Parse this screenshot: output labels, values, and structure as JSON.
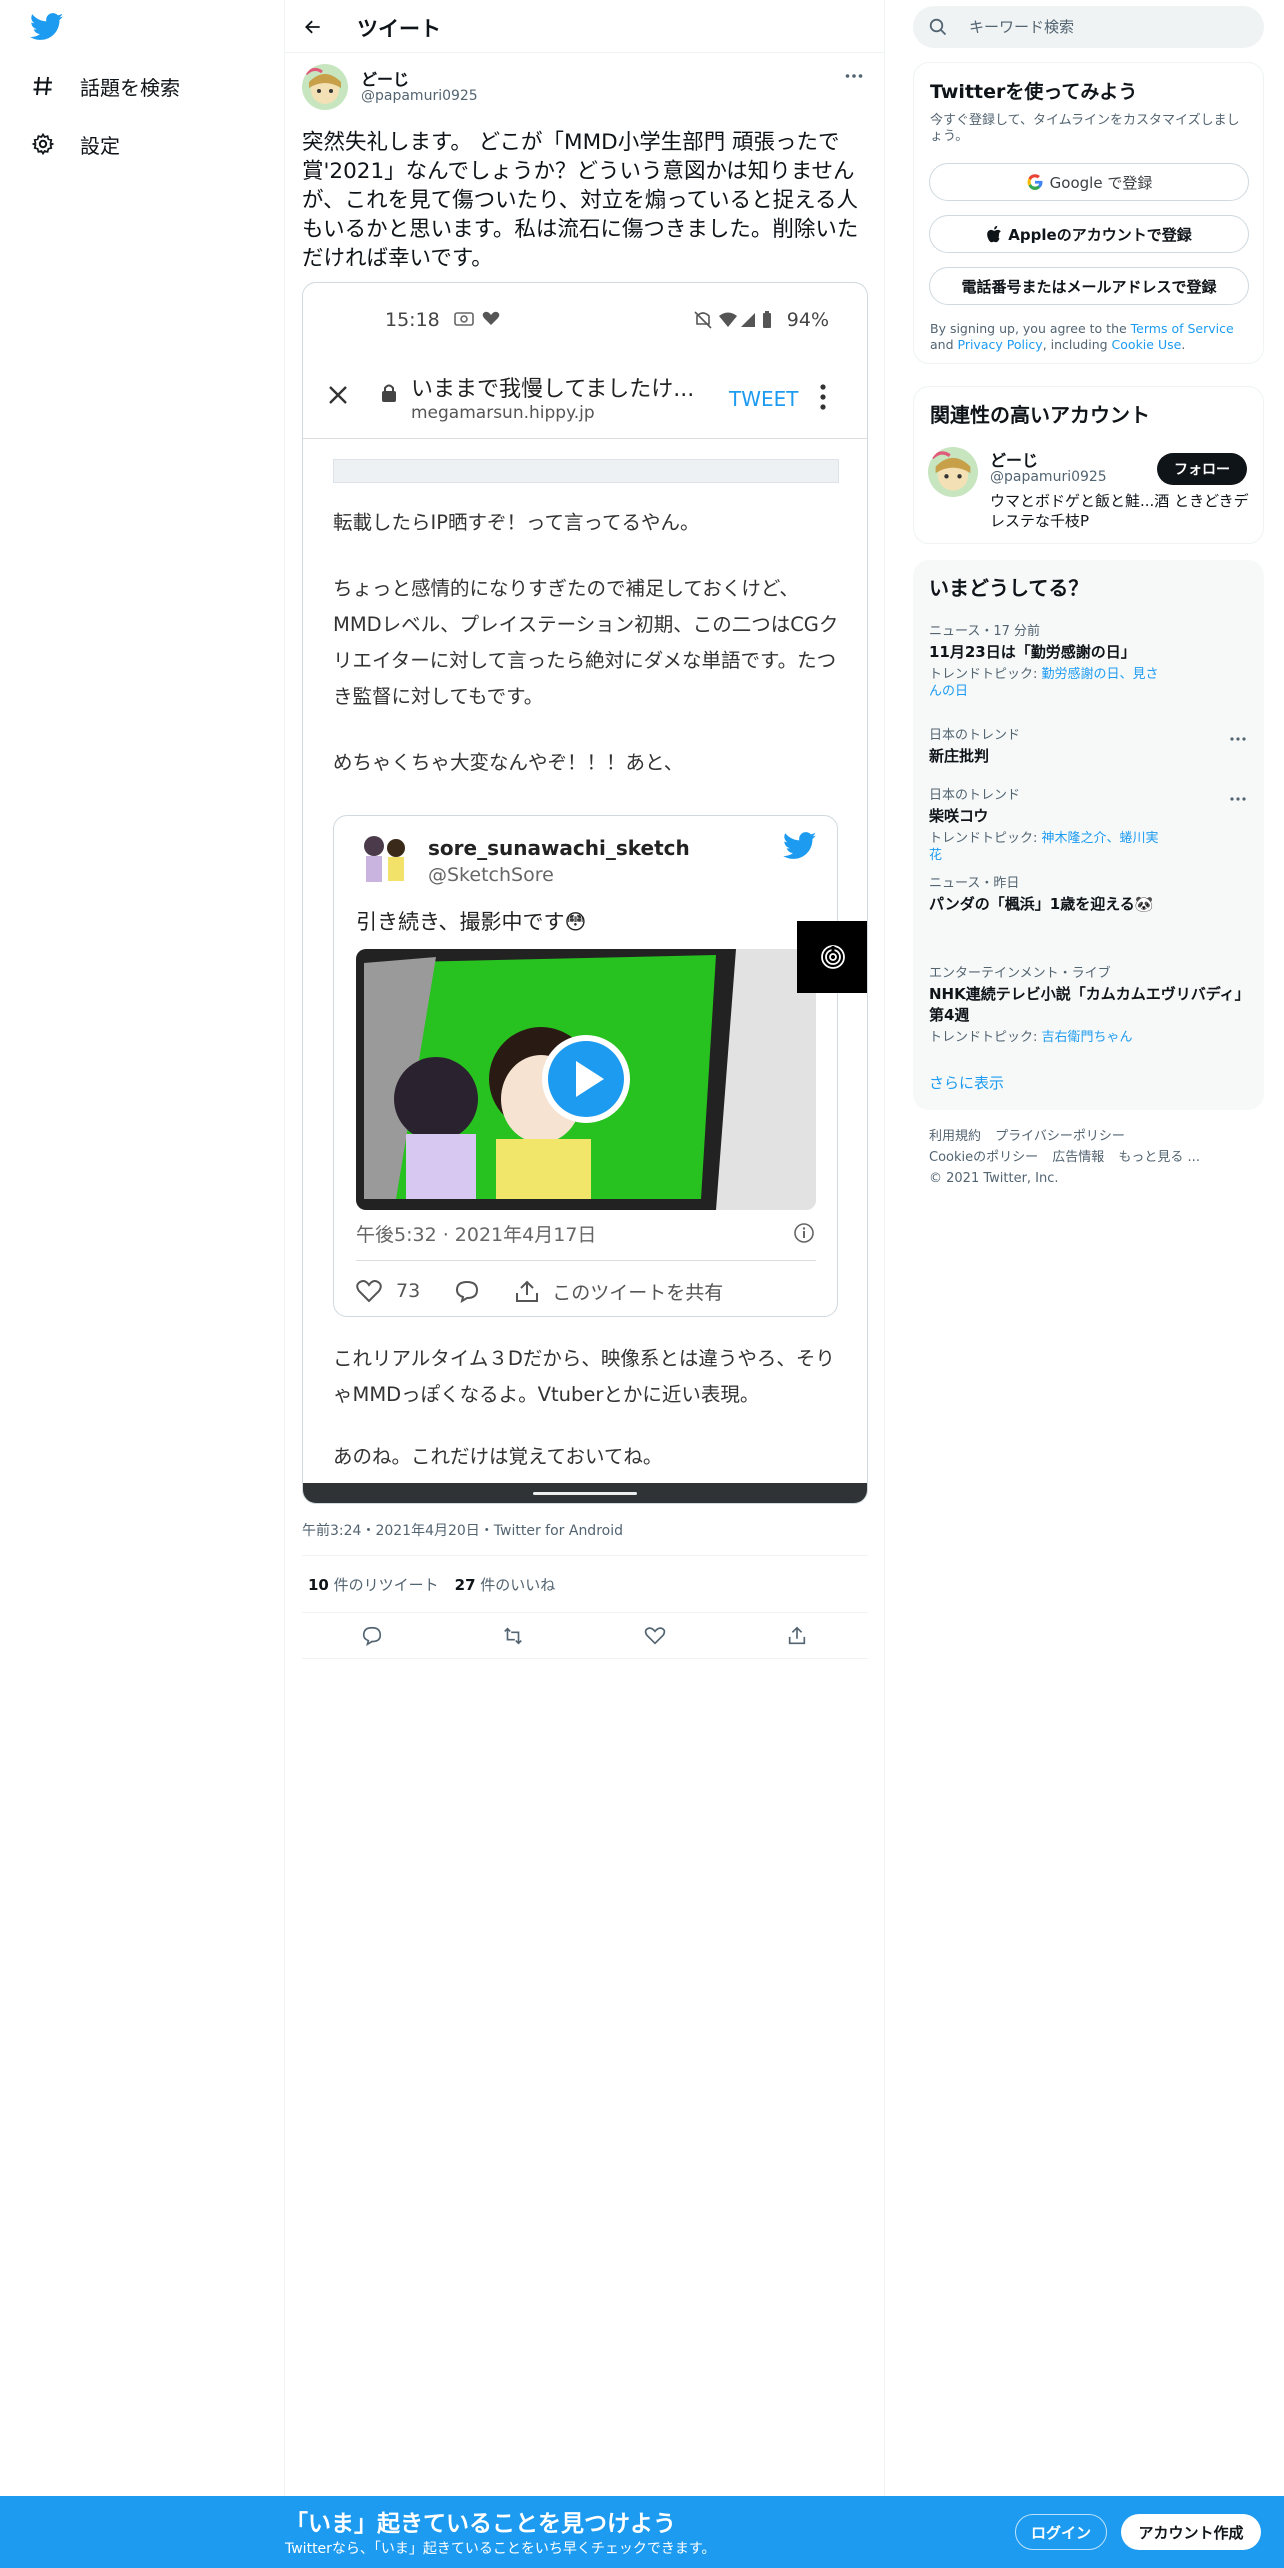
{
  "colors": {
    "accent": "#1d9bf0",
    "text": "#0f1419",
    "muted": "#536471",
    "banner": "#1d9bf0"
  },
  "nav": {
    "logo_icon": "twitter-bird-icon",
    "items": [
      {
        "label": "話題を検索",
        "icon": "hashtag-icon"
      },
      {
        "label": "設定",
        "icon": "gear-icon"
      }
    ]
  },
  "header": {
    "title": "ツイート",
    "back_icon": "arrow-left-icon"
  },
  "tweet": {
    "author_name": "どーじ",
    "author_handle": "@papamuri0925",
    "text": "突然失礼します。 どこが「MMD小学生部門 頑張ったで賞'2021」なんでしょうか？どういう意図かは知りませんが、これを見て傷ついたり、対立を煽っていると捉える人もいるかと思います。私は流石に傷つきました。削除いただければ幸いです。",
    "meta": "午前3:24・2021年4月20日・Twitter for Android",
    "retweet_count": "10",
    "retweet_label": " 件のリツイート",
    "like_count": "27",
    "like_label": " 件のいいね"
  },
  "phone": {
    "time": "15:18",
    "battery": "94%",
    "browser_title": "いままで我慢してましたけ...",
    "browser_url": "megamarsun.hippy.jp",
    "browser_tweet": "TWEET",
    "para1": "転載したらIP晒すぞ！って言ってるやん。",
    "para2": "ちょっと感情的になりすぎたので補足しておくけど、MMDレベル、プレイステーション初期、この二つはCGクリエイターに対して言ったら絶対にダメな単語です。たつき監督に対してもです。",
    "para3": "めちゃくちゃ大変なんやぞ！！！あと、",
    "para4": "これリアルタイム３Dだから、映像系とは違うやろ、そりゃMMDっぽくなるよ。Vtuberとかに近い表現。",
    "para5": "あのね。これだけは覚えておいてね。",
    "embed": {
      "name": "sore_sunawachi_sketch",
      "handle": "@SketchSore",
      "text": "引き続き、撮影中です😳",
      "time": "午後5:32 · 2021年4月17日",
      "likes": "73",
      "share": "このツイートを共有"
    }
  },
  "search": {
    "placeholder": "キーワード検索"
  },
  "signup": {
    "title": "Twitterを使ってみよう",
    "subtitle": "今すぐ登録して、タイムラインをカスタマイズしましょう。",
    "google": "Google で登録",
    "apple": "Appleのアカウントで登録",
    "phone": "電話番号またはメールアドレスで登録",
    "terms_1": "By signing up, you agree to the ",
    "terms_link1": "Terms of Service",
    "terms_2": " and ",
    "terms_link2": "Privacy Policy",
    "terms_3": ", including ",
    "terms_link3": "Cookie Use",
    "terms_4": "."
  },
  "related": {
    "title": "関連性の高いアカウント",
    "name": "どーじ",
    "handle": "@papamuri0925",
    "bio": "ウマとボドゲと飯と鮭...酒 ときどきデレステな千枝P",
    "follow": "フォロー"
  },
  "trends": {
    "title": "いまどうしてる？",
    "items": [
      {
        "context": "ニュース・17 分前",
        "name": "11月23日は「勤労感謝の日」",
        "topic_prefix": "トレンドトピック: ",
        "topic": "勤労感謝の日、見さんの日"
      },
      {
        "context": "日本のトレンド",
        "name": "新庄批判",
        "topic_prefix": "",
        "topic": ""
      },
      {
        "context": "日本のトレンド",
        "name": "柴咲コウ",
        "topic_prefix": "トレンドトピック: ",
        "topic": "神木隆之介、蜷川実花"
      },
      {
        "context": "ニュース・昨日",
        "name": "パンダの「楓浜」1歳を迎える🐼",
        "topic_prefix": "",
        "topic": ""
      },
      {
        "context": "エンターテインメント・ライブ",
        "name": "NHK連続テレビ小説「カムカムエヴリバディ」第4週",
        "topic_prefix": "トレンドトピック: ",
        "topic": "吉右衛門ちゃん"
      }
    ],
    "show_more": "さらに表示"
  },
  "footer": {
    "links": [
      "利用規約",
      "プライバシーポリシー",
      "Cookieのポリシー",
      "広告情報",
      "もっと見る ..."
    ],
    "copyright": "© 2021 Twitter, Inc."
  },
  "banner": {
    "title": "「いま」起きていることを見つけよう",
    "subtitle": "Twitterなら、「いま」起きていることをいち早くチェックできます。",
    "login": "ログイン",
    "signup": "アカウント作成"
  }
}
